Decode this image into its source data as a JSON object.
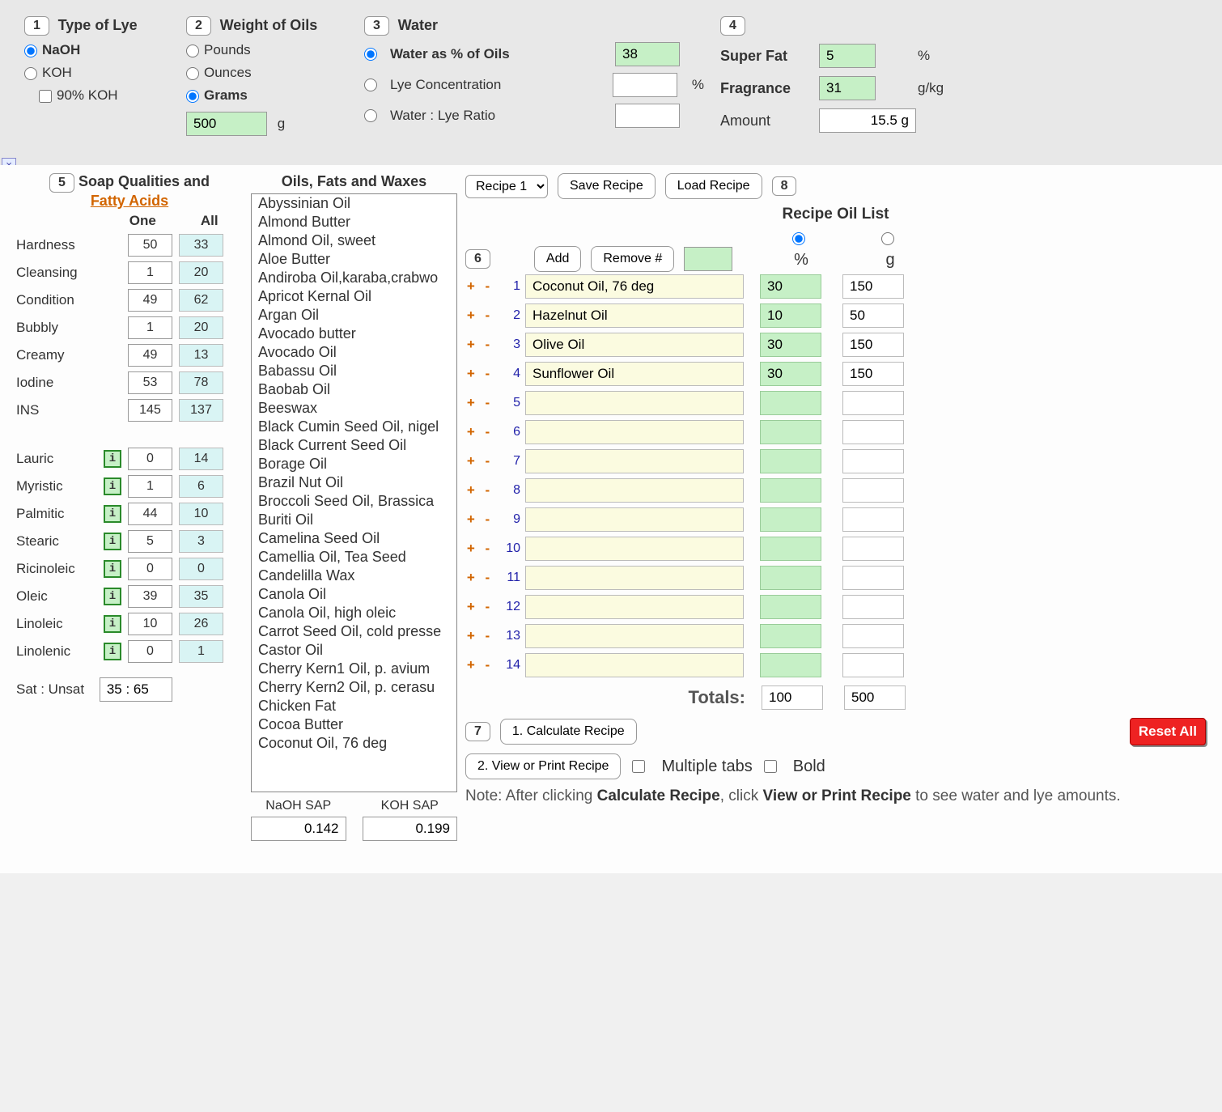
{
  "sec1": {
    "num": "1",
    "title": "Type of Lye",
    "naoh": "NaOH",
    "koh": "KOH",
    "koh90": "90% KOH"
  },
  "sec2": {
    "num": "2",
    "title": "Weight of Oils",
    "pounds": "Pounds",
    "ounces": "Ounces",
    "grams": "Grams",
    "value": "500",
    "unit": "g"
  },
  "sec3": {
    "num": "3",
    "title": "Water",
    "opt1": "Water as % of Oils",
    "opt2": "Lye Concentration",
    "opt3": "Water : Lye Ratio",
    "val1": "38",
    "unit2": "%"
  },
  "sec4": {
    "num": "4",
    "superfat_lbl": "Super Fat",
    "superfat_val": "5",
    "superfat_unit": "%",
    "frag_lbl": "Fragrance",
    "frag_val": "31",
    "frag_unit": "g/kg",
    "amount_lbl": "Amount",
    "amount_val": "15.5 g"
  },
  "qual": {
    "num": "5",
    "title": "Soap Qualities and",
    "fatty": "Fatty Acids",
    "one_h": "One",
    "all_h": "All",
    "rows": [
      {
        "l": "Hardness",
        "o": "50",
        "a": "33",
        "i": false
      },
      {
        "l": "Cleansing",
        "o": "1",
        "a": "20",
        "i": false
      },
      {
        "l": "Condition",
        "o": "49",
        "a": "62",
        "i": false
      },
      {
        "l": "Bubbly",
        "o": "1",
        "a": "20",
        "i": false
      },
      {
        "l": "Creamy",
        "o": "49",
        "a": "13",
        "i": false
      },
      {
        "l": "Iodine",
        "o": "53",
        "a": "78",
        "i": false
      },
      {
        "l": "INS",
        "o": "145",
        "a": "137",
        "i": false
      }
    ],
    "acids": [
      {
        "l": "Lauric",
        "o": "0",
        "a": "14"
      },
      {
        "l": "Myristic",
        "o": "1",
        "a": "6"
      },
      {
        "l": "Palmitic",
        "o": "44",
        "a": "10"
      },
      {
        "l": "Stearic",
        "o": "5",
        "a": "3"
      },
      {
        "l": "Ricinoleic",
        "o": "0",
        "a": "0"
      },
      {
        "l": "Oleic",
        "o": "39",
        "a": "35"
      },
      {
        "l": "Linoleic",
        "o": "10",
        "a": "26"
      },
      {
        "l": "Linolenic",
        "o": "0",
        "a": "1"
      }
    ],
    "sat_lbl": "Sat : Unsat",
    "sat_val": "35 : 65"
  },
  "oils": {
    "title": "Oils, Fats and Waxes",
    "list": [
      "Abyssinian Oil",
      "Almond Butter",
      "Almond Oil, sweet",
      "Aloe Butter",
      "Andiroba Oil,karaba,crabwo",
      "Apricot Kernal Oil",
      "Argan Oil",
      "Avocado butter",
      "Avocado Oil",
      "Babassu Oil",
      "Baobab Oil",
      "Beeswax",
      "Black Cumin Seed Oil, nigel",
      "Black Current Seed Oil",
      "Borage Oil",
      "Brazil Nut Oil",
      "Broccoli Seed Oil, Brassica",
      "Buriti Oil",
      "Camelina Seed Oil",
      "Camellia Oil, Tea Seed",
      "Candelilla Wax",
      "Canola Oil",
      "Canola Oil, high oleic",
      "Carrot Seed Oil, cold presse",
      "Castor Oil",
      "Cherry Kern1 Oil, p. avium",
      "Cherry Kern2 Oil, p. cerasu",
      "Chicken Fat",
      "Cocoa Butter",
      "Coconut Oil, 76 deg"
    ],
    "naoh_lbl": "NaOH SAP",
    "koh_lbl": "KOH SAP",
    "naoh_val": "0.142",
    "koh_val": "0.199"
  },
  "recipe": {
    "sel": "Recipe 1",
    "save": "Save Recipe",
    "load": "Load Recipe",
    "eight": "8",
    "title": "Recipe Oil List",
    "six": "6",
    "add": "Add",
    "remove": "Remove #",
    "pct_h": "%",
    "g_h": "g",
    "rows": [
      {
        "name": "Coconut Oil, 76 deg",
        "p": "30",
        "g": "150"
      },
      {
        "name": "Hazelnut Oil",
        "p": "10",
        "g": "50"
      },
      {
        "name": "Olive Oil",
        "p": "30",
        "g": "150"
      },
      {
        "name": "Sunflower Oil",
        "p": "30",
        "g": "150"
      },
      {
        "name": "",
        "p": "",
        "g": ""
      },
      {
        "name": "",
        "p": "",
        "g": ""
      },
      {
        "name": "",
        "p": "",
        "g": ""
      },
      {
        "name": "",
        "p": "",
        "g": ""
      },
      {
        "name": "",
        "p": "",
        "g": ""
      },
      {
        "name": "",
        "p": "",
        "g": ""
      },
      {
        "name": "",
        "p": "",
        "g": ""
      },
      {
        "name": "",
        "p": "",
        "g": ""
      },
      {
        "name": "",
        "p": "",
        "g": ""
      },
      {
        "name": "",
        "p": "",
        "g": ""
      }
    ],
    "totals_lbl": "Totals:",
    "tot_pct": "100",
    "tot_g": "500",
    "seven": "7",
    "calc": "1. Calculate Recipe",
    "reset": "Reset All",
    "view": "2. View or Print Recipe",
    "multi": "Multiple tabs",
    "bold": "Bold",
    "note_a": "Note: After clicking ",
    "note_b": "Calculate Recipe",
    "note_c": ", click ",
    "note_d": "View or Print Recipe",
    "note_e": " to see water and lye amounts."
  }
}
